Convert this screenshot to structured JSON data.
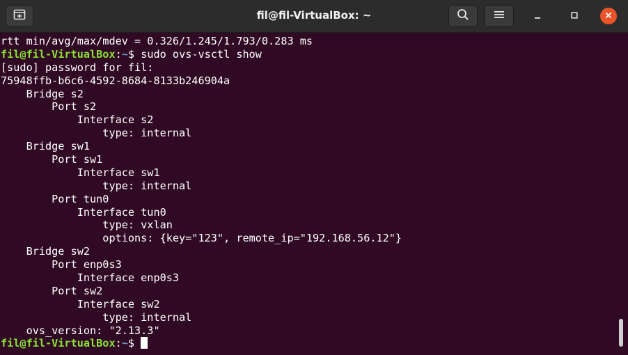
{
  "window": {
    "title": "fil@fil-VirtualBox: ~"
  },
  "icons": {
    "new_tab": "new-tab-icon",
    "search": "search-icon",
    "menu": "hamburger-menu-icon",
    "minimize": "minimize-icon",
    "maximize": "maximize-icon",
    "close": "close-icon"
  },
  "colors": {
    "terminal_bg": "#300a24",
    "prompt_user": "#8ae234",
    "prompt_path": "#729fcf",
    "close_button": "#e9542a"
  },
  "terminal": {
    "rtt_line": "rtt min/avg/max/mdev = 0.326/1.245/1.793/0.283 ms",
    "prompt1": {
      "user": "fil@fil-VirtualBox",
      "colon": ":",
      "path": "~",
      "symbol": "$ ",
      "command": "sudo ovs-vsctl show"
    },
    "output": [
      "[sudo] password for fil:",
      "75948ffb-b6c6-4592-8684-8133b246904a",
      "    Bridge s2",
      "        Port s2",
      "            Interface s2",
      "                type: internal",
      "    Bridge sw1",
      "        Port sw1",
      "            Interface sw1",
      "                type: internal",
      "        Port tun0",
      "            Interface tun0",
      "                type: vxlan",
      "                options: {key=\"123\", remote_ip=\"192.168.56.12\"}",
      "    Bridge sw2",
      "        Port enp0s3",
      "            Interface enp0s3",
      "        Port sw2",
      "            Interface sw2",
      "                type: internal",
      "    ovs_version: \"2.13.3\""
    ],
    "prompt2": {
      "user": "fil@fil-VirtualBox",
      "colon": ":",
      "path": "~",
      "symbol": "$ "
    }
  }
}
